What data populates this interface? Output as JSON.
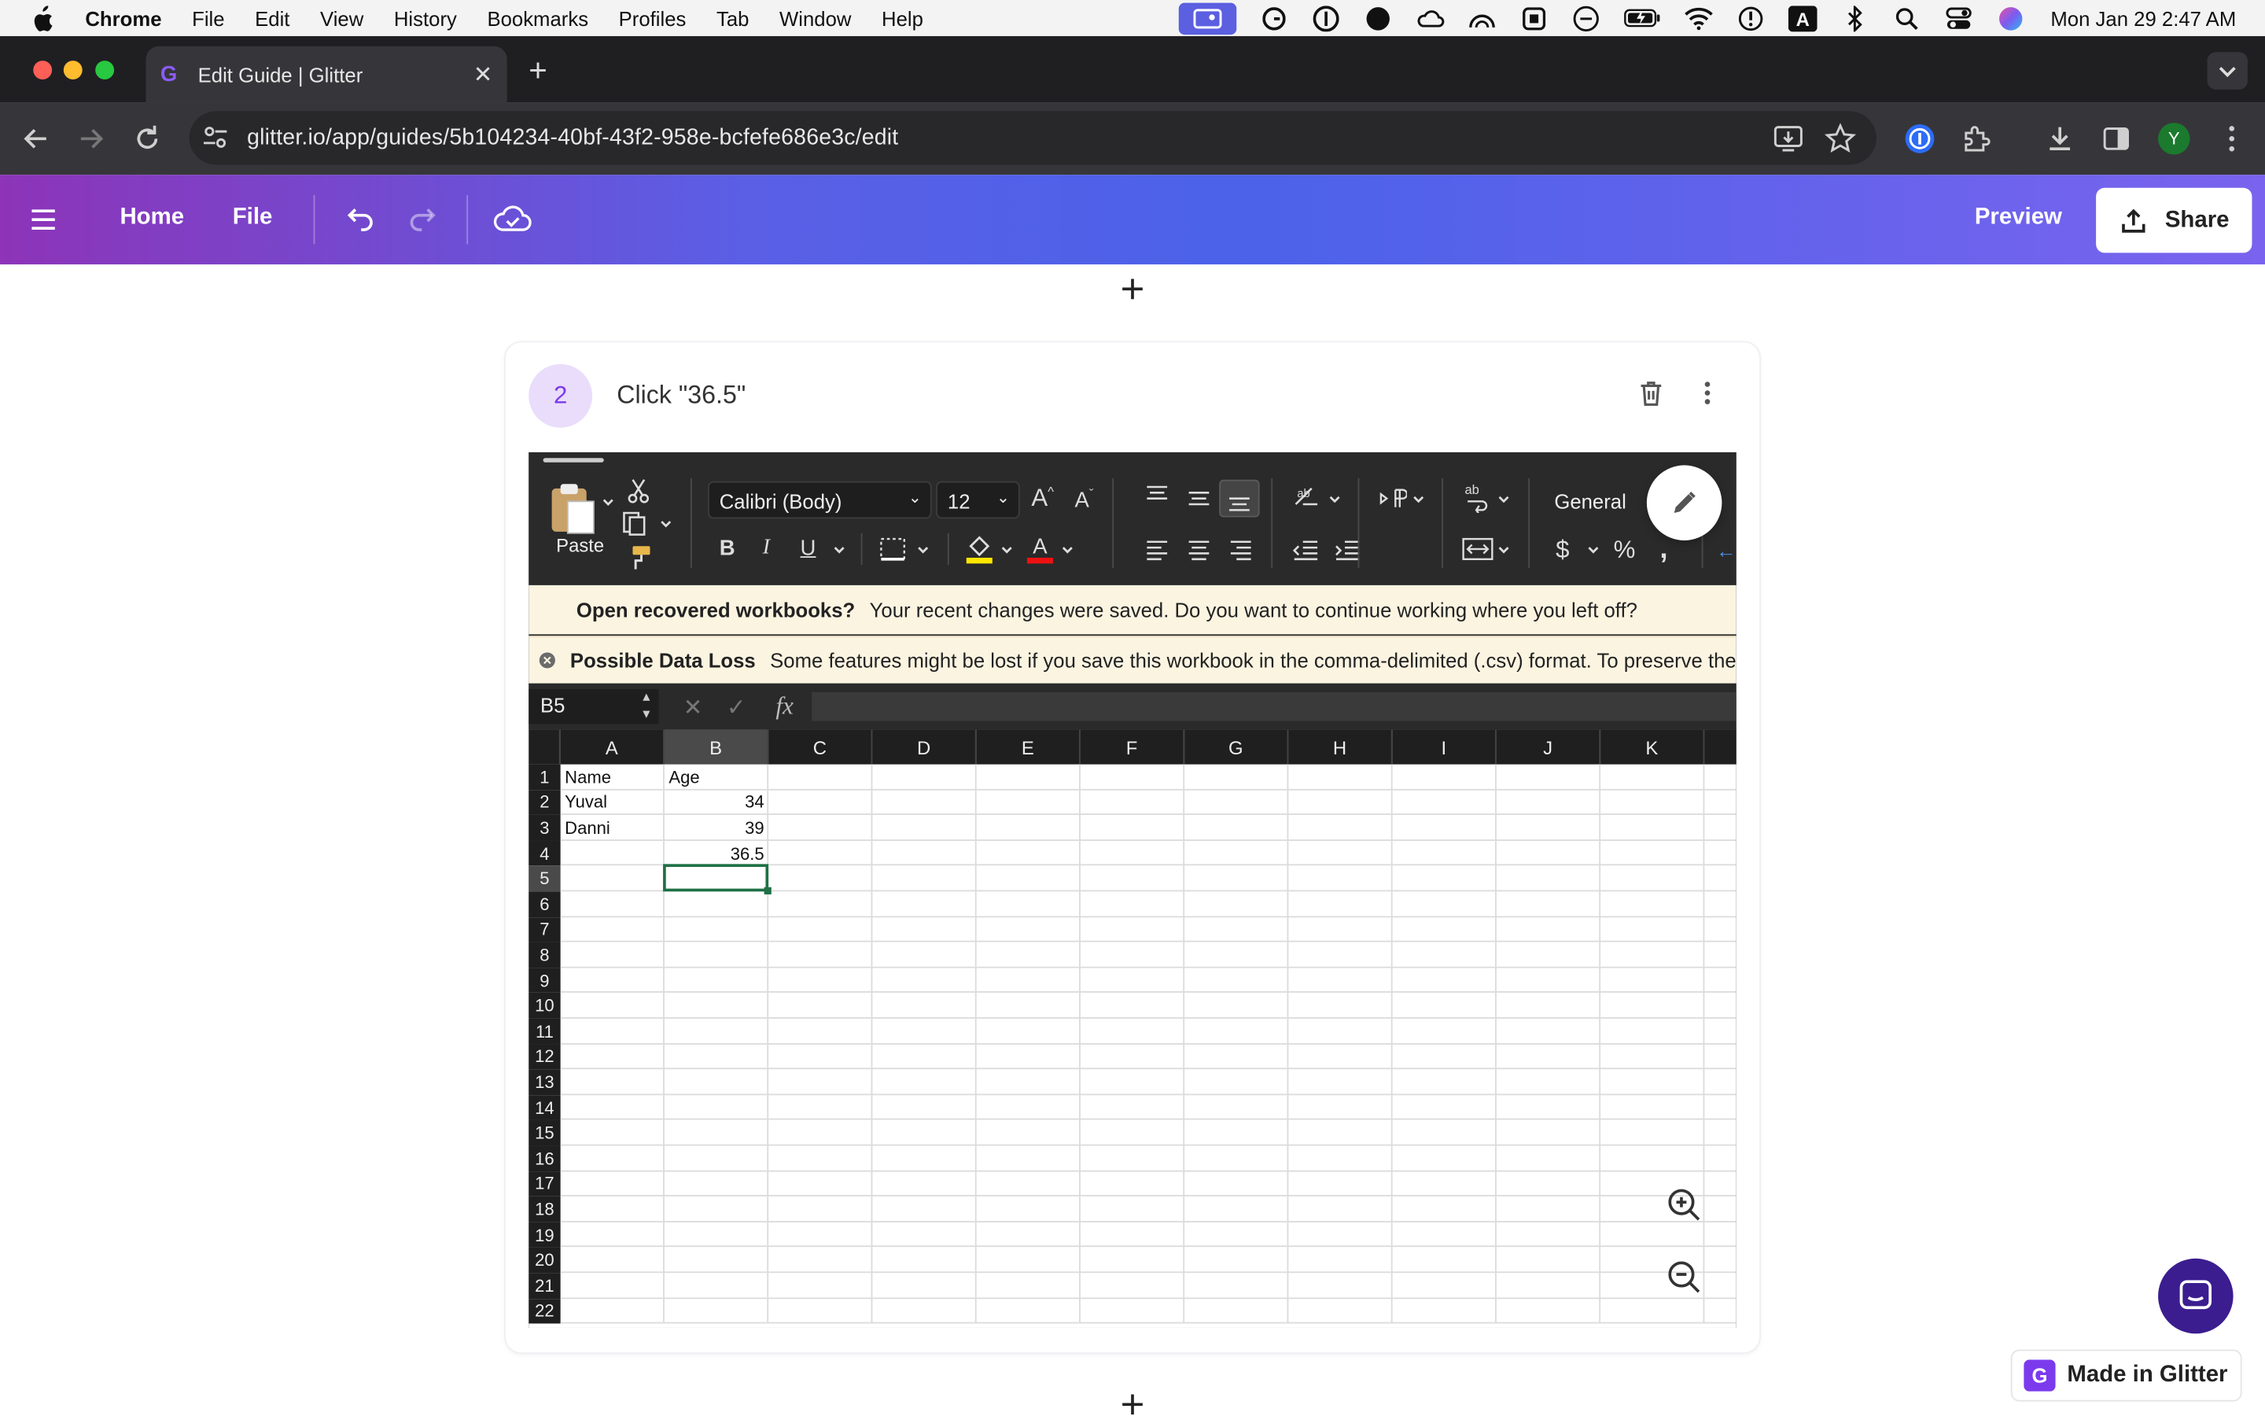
{
  "menubar": {
    "app": "Chrome",
    "items": [
      "File",
      "Edit",
      "View",
      "History",
      "Bookmarks",
      "Profiles",
      "Tab",
      "Window",
      "Help"
    ],
    "clock": "Mon Jan 29  2:47 AM"
  },
  "browser": {
    "tab_title": "Edit Guide | Glitter",
    "url": "glitter.io/app/guides/5b104234-40bf-43f2-958e-bcfefe686e3c/edit",
    "profile_initial": "Y"
  },
  "app_header": {
    "home_label": "Home",
    "file_label": "File",
    "preview_label": "Preview",
    "share_label": "Share"
  },
  "step": {
    "number": "2",
    "title": "Click \"36.5\""
  },
  "excel": {
    "font_name": "Calibri (Body)",
    "font_size": "12",
    "number_format": "General",
    "paste_label": "Paste",
    "recovered": {
      "title": "Open recovered workbooks?",
      "message": "Your recent changes were saved. Do you want to continue working where you left off?"
    },
    "data_loss": {
      "title": "Possible Data Loss",
      "message": "Some features might be lost if you save this workbook in the comma-delimited (.csv) format. To preserve the"
    },
    "name_box": "B5",
    "fx_label": "fx",
    "columns": [
      "A",
      "B",
      "C",
      "D",
      "E",
      "F",
      "G",
      "H",
      "I",
      "J",
      "K"
    ],
    "rows": [
      "1",
      "2",
      "3",
      "4",
      "5",
      "6",
      "7",
      "8",
      "9",
      "10",
      "11",
      "12",
      "13",
      "14",
      "15",
      "16",
      "17",
      "18",
      "19",
      "20",
      "21",
      "22"
    ],
    "cells": {
      "A1": "Name",
      "B1": "Age",
      "A2": "Yuval",
      "B2": "34",
      "A3": "Danni",
      "B3": "39",
      "B4": "36.5"
    },
    "selected_cell": "B5"
  },
  "footer": {
    "badge_label": "Made in Glitter"
  },
  "colors": {
    "accent_purple": "#7c3aed",
    "excel_green": "#1e7145",
    "header_gradient_start": "#8d34b8",
    "header_gradient_end": "#7a63ee"
  }
}
